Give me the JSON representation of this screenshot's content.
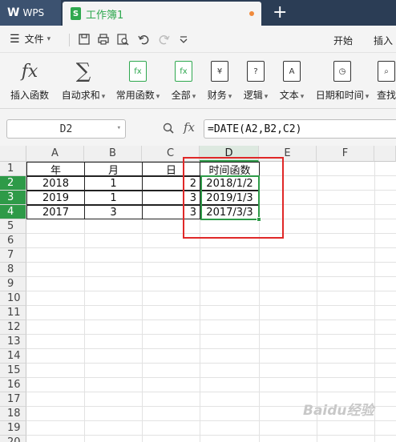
{
  "titlebar": {
    "app_name": "WPS",
    "app_logo": "W",
    "doc_tab_title": "工作簿1",
    "doc_icon_letter": "S",
    "add_tab": "+"
  },
  "menubar": {
    "file_label": "文件",
    "tabs": [
      "开始",
      "插入"
    ]
  },
  "ribbon": {
    "buttons": [
      {
        "label": "插入函数",
        "icon": "fx-icon"
      },
      {
        "label": "自动求和",
        "icon": "sigma-icon"
      },
      {
        "label": "常用函数",
        "icon": "fx-book-icon"
      },
      {
        "label": "全部",
        "icon": "fx-book-icon"
      },
      {
        "label": "财务",
        "icon": "yen-book-icon"
      },
      {
        "label": "逻辑",
        "icon": "question-book-icon"
      },
      {
        "label": "文本",
        "icon": "a-book-icon"
      },
      {
        "label": "日期和时间",
        "icon": "clock-book-icon"
      },
      {
        "label": "查找",
        "icon": "search-book-icon"
      }
    ],
    "book_glyphs": {
      "fx": "fx",
      "yen": "¥",
      "question": "?",
      "a": "A",
      "clock": "◷",
      "search": "⌕"
    }
  },
  "formula_bar": {
    "name_box": "D2",
    "fx_label": "fx",
    "formula": "=DATE(A2,B2,C2)"
  },
  "sheet": {
    "columns": [
      "A",
      "B",
      "C",
      "D",
      "E",
      "F"
    ],
    "rows": [
      "1",
      "2",
      "3",
      "4",
      "5",
      "6",
      "7",
      "8",
      "9",
      "10",
      "11",
      "12",
      "13",
      "14",
      "15",
      "16",
      "17",
      "18",
      "19",
      "20"
    ],
    "selected_column": "D",
    "selected_rows": [
      "2",
      "3",
      "4"
    ],
    "header_row": [
      "年",
      "月",
      "日",
      "时间函数"
    ],
    "data_rows": [
      [
        "2018",
        "1",
        "2",
        "2018/1/2"
      ],
      [
        "2019",
        "1",
        "3",
        "2019/1/3"
      ],
      [
        "2017",
        "3",
        "3",
        "2017/3/3"
      ]
    ]
  },
  "colors": {
    "title_bg": "#2b3d55",
    "accent_green": "#2e9a48",
    "highlight_red": "#e02828"
  },
  "watermark": "Baidu经验"
}
